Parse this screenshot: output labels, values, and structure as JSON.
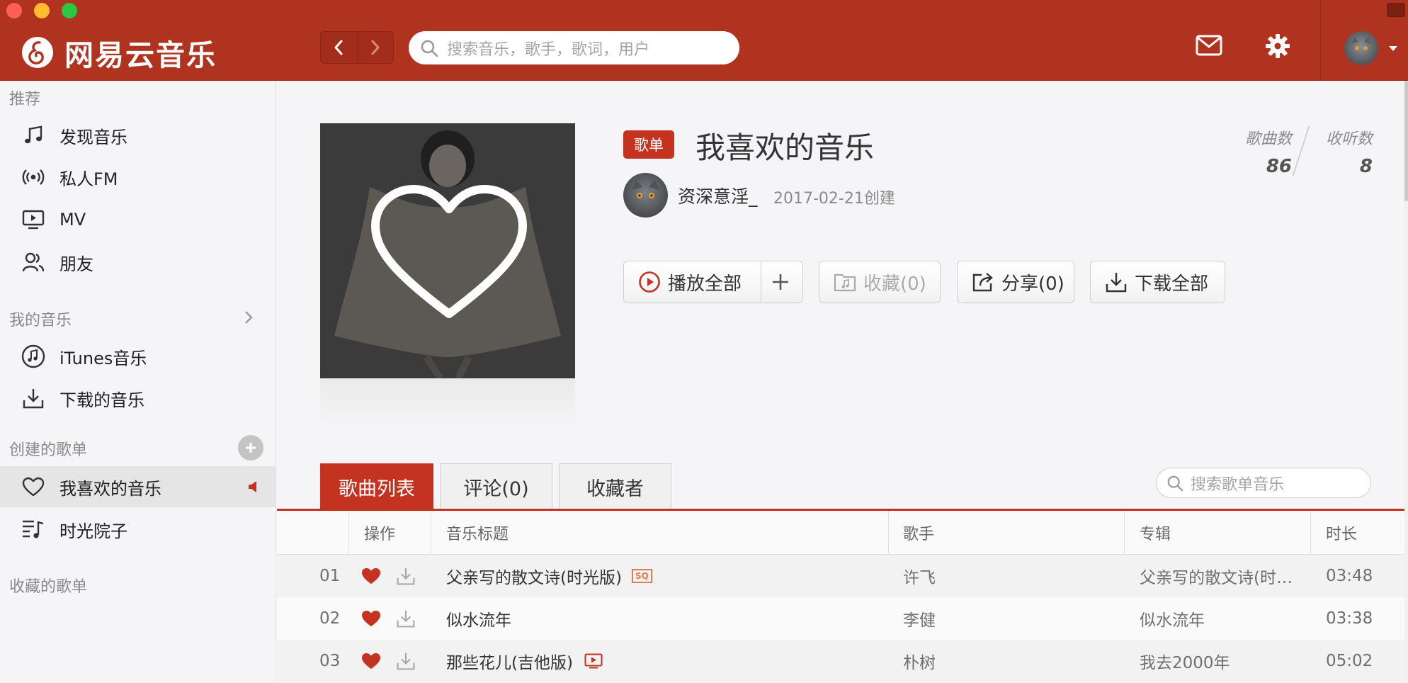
{
  "app": {
    "name": "网易云音乐",
    "search_placeholder": "搜索音乐，歌手，歌词，用户",
    "colors": {
      "accent": "#c3331f",
      "topbar": "#b0331f"
    }
  },
  "sidebar": {
    "recommend_header": "推荐",
    "recommend_items": [
      {
        "label": "发现音乐",
        "icon": "music-note-icon"
      },
      {
        "label": "私人FM",
        "icon": "radio-icon"
      },
      {
        "label": "MV",
        "icon": "mv-icon"
      },
      {
        "label": "朋友",
        "icon": "friends-icon"
      }
    ],
    "my_music_header": "我的音乐",
    "my_music_items": [
      {
        "label": "iTunes音乐",
        "icon": "itunes-icon"
      },
      {
        "label": "下载的音乐",
        "icon": "download-icon"
      }
    ],
    "created_header": "创建的歌单",
    "created_items": [
      {
        "label": "我喜欢的音乐",
        "icon": "heart-icon",
        "active": true
      },
      {
        "label": "时光院子",
        "icon": "playlist-icon"
      }
    ],
    "collected_header": "收藏的歌单"
  },
  "playlist": {
    "badge": "歌单",
    "title": "我喜欢的音乐",
    "creator": "资深意淫_",
    "created": "2017-02-21创建",
    "stats": {
      "songs_label": "歌曲数",
      "songs": "86",
      "plays_label": "收听数",
      "plays": "8"
    },
    "actions": {
      "play_all": "播放全部",
      "collect": "收藏(0)",
      "share": "分享(0)",
      "download_all": "下载全部"
    }
  },
  "tabs": {
    "songs": "歌曲列表",
    "comments": "评论(0)",
    "collectors": "收藏者"
  },
  "list_search_placeholder": "搜索歌单音乐",
  "table": {
    "headers": {
      "ops": "操作",
      "title": "音乐标题",
      "artist": "歌手",
      "album": "专辑",
      "duration": "时长"
    },
    "rows": [
      {
        "index": "01",
        "title": "父亲写的散文诗(时光版)",
        "badge": "SQ",
        "artist": "许飞",
        "album": "父亲写的散文诗(时…",
        "duration": "03:48"
      },
      {
        "index": "02",
        "title": "似水流年",
        "artist": "李健",
        "album": "似水流年",
        "duration": "03:38"
      },
      {
        "index": "03",
        "title": "那些花儿(吉他版)",
        "artist": "朴树",
        "album": "我去2000年",
        "duration": "05:02"
      }
    ]
  }
}
